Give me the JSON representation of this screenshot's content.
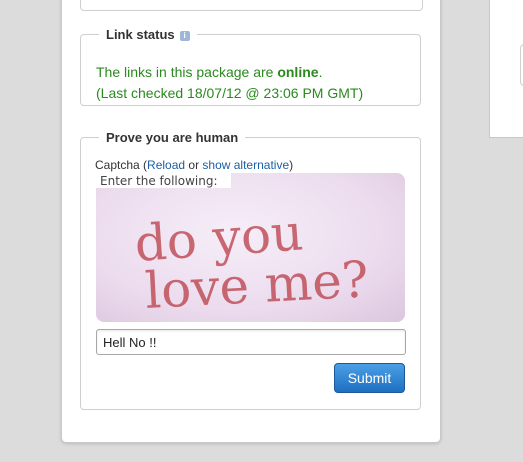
{
  "link_status": {
    "legend": "Link status",
    "online_prefix": "The links in this package are ",
    "online_word": "online",
    "online_suffix": ".",
    "last_checked": "(Last checked 18/07/12 @ 23:06 PM GMT)"
  },
  "human": {
    "legend": "Prove you are human",
    "captcha_prefix": "Captcha (",
    "reload_label": "Reload",
    "or_text": " or ",
    "alternative_label": "show alternative",
    "captcha_suffix": ")",
    "captcha_instruction": "Enter the following:",
    "captcha_line1": "do you",
    "captcha_line2": "love me?",
    "answer_value": "Hell No !!",
    "submit_label": "Submit"
  },
  "colors": {
    "status_green": "#2a8a1e",
    "link_blue": "#1b5fa5",
    "button_blue": "#1f6fc1"
  }
}
